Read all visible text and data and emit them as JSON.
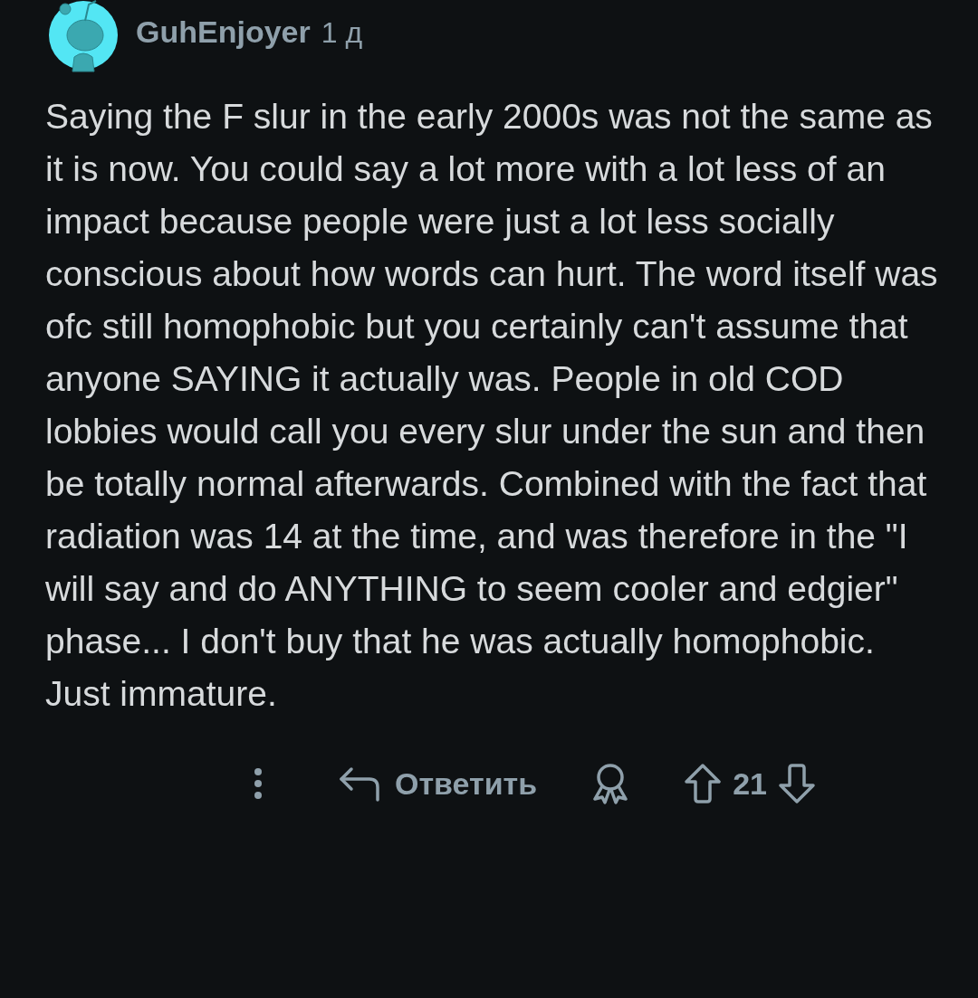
{
  "comment": {
    "author": "GuhEnjoyer",
    "age": "1 д",
    "body": "Saying the F slur in the early 2000s was not the same as it is now. You could say a lot more with a lot less of an impact because people were just a lot less socially conscious about how words can hurt. The word itself was ofc still homophobic but you certainly can't assume that anyone SAYING it actually was. People in old COD lobbies would call you every slur under the sun and then be totally normal afterwards. Combined with the fact that radiation was 14 at the time, and was therefore in the \"I will say and do ANYTHING to seem cooler and edgier\" phase... I don't buy that he was actually homophobic. Just immature.",
    "reply_label": "Ответить",
    "score": "21"
  }
}
